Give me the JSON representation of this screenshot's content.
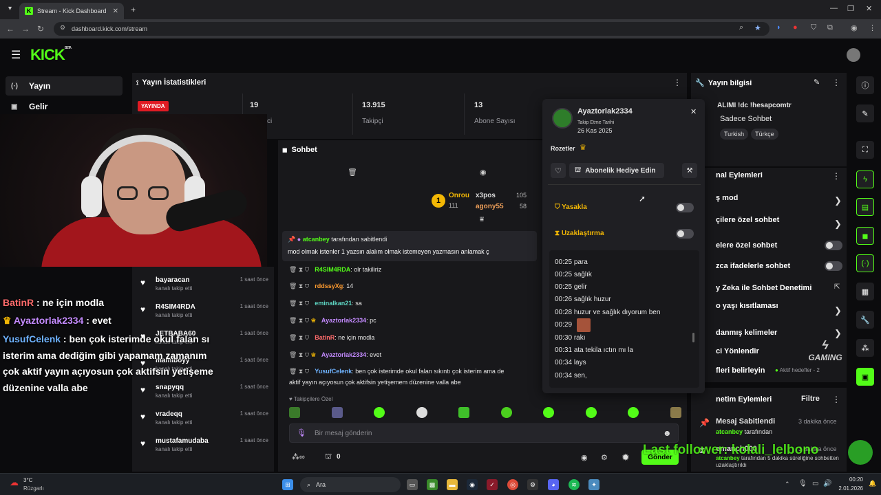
{
  "browser": {
    "tab_title": "Stream - Kick Dashboard",
    "url": "dashboard.kick.com/stream"
  },
  "header": {
    "logo": "KICK",
    "logo_sup": "BETA"
  },
  "sidebar": {
    "items": [
      {
        "label": "Yayın",
        "icon": "broadcast-icon"
      },
      {
        "label": "Gelir",
        "icon": "revenue-icon"
      }
    ]
  },
  "stats": {
    "title": "Yayın İstatistikleri",
    "live_badge": "YAYINDA",
    "viewers_value": "19",
    "viewers_label": "ci",
    "followers_value": "13.915",
    "followers_label": "Takipçi",
    "subs_value": "13",
    "subs_label": "Abone Sayısı"
  },
  "followers_list": [
    {
      "name": "bayaracan",
      "sub": "kanalı takip etti",
      "time": "1 saat önce"
    },
    {
      "name": "R4SIM4RDA",
      "sub": "kanalı takip etti",
      "time": "1 saat önce"
    },
    {
      "name": "JETBABA60",
      "sub": "kanalı takip etti",
      "time": "1 saat önce"
    },
    {
      "name": "mamiboyy",
      "sub": "kanalı takip etti",
      "time": "1 saat önce"
    },
    {
      "name": "snapyqq",
      "sub": "kanalı takip etti",
      "time": "1 saat önce"
    },
    {
      "name": "vradeqq",
      "sub": "kanalı takip etti",
      "time": "1 saat önce"
    },
    {
      "name": "mustafamudaba",
      "sub": "kanalı takip etti",
      "time": "1 saat önce"
    }
  ],
  "overlay_chat": [
    {
      "user": "BatinR",
      "text": " : ne için modla"
    },
    {
      "user": "Ayaztorlak2334",
      "text": " : evet"
    },
    {
      "user": "YusufCelenk",
      "text": " : ben çok isterimde okul falan sı"
    },
    {
      "user": "",
      "text": "isterim ama dediğim gibi yapamam zamanım"
    },
    {
      "user": "",
      "text": "çok aktif yayın açıyosun çok aktifsin yetişeme"
    },
    {
      "user": "",
      "text": "düzenine valla abe"
    }
  ],
  "chat": {
    "title": "Sohbet",
    "leaderboard": [
      {
        "name": "Onrou",
        "points": "111"
      },
      {
        "name": "x3pos",
        "points": "105"
      },
      {
        "name": "agony55",
        "points": "58"
      }
    ],
    "pinned_by": "atcanbey",
    "pinned_suffix": "tarafından sabitlendi",
    "pinned_text": "mod olmak istenler 1 yazsın alalım olmak istemeyen yazmasın anlamak ç",
    "messages": [
      {
        "user": "R4SIM4RDA",
        "text": ": olr takiliriz"
      },
      {
        "user": "rddssyXg",
        "text": ": 14"
      },
      {
        "user": "eminalkan21",
        "text": ": sa"
      },
      {
        "user": "Ayaztorlak2334",
        "text": ": pc"
      },
      {
        "user": "BatinR",
        "text": ": ne için modla"
      },
      {
        "user": "Ayaztorlak2334",
        "text": ": evet"
      },
      {
        "user": "YusufCelenk",
        "text": ": ben çok isterimde okul falan sıkıntı çok isterim ama de"
      }
    ],
    "wrap_line": "aktif yayın açıyosun çok aktifsin yetişemem düzenine valla abe",
    "followers_only": "Takipçilere Özel",
    "input_placeholder": "Bir mesaj gönderin",
    "count": "0",
    "send_label": "Gönder"
  },
  "usercard": {
    "username": "Ayaztorlak2334",
    "follow_label": "Takip Etme Tarihi",
    "follow_date": "26 Kas 2025",
    "badges_label": "Rozetler",
    "gift_label": "Abonelik Hediye Edin",
    "ban_label": "Yasakla",
    "timeout_label": "Uzaklaştırma",
    "logs": [
      {
        "time": "00:25",
        "text": "para"
      },
      {
        "time": "00:25",
        "text": "sağlık"
      },
      {
        "time": "00:25",
        "text": "gelir"
      },
      {
        "time": "00:26",
        "text": "sağlık huzur"
      },
      {
        "time": "00:28",
        "text": "huzur ve sağlık dıyorum ben"
      },
      {
        "time": "00:29",
        "text": ""
      },
      {
        "time": "00:30",
        "text": "rakı"
      },
      {
        "time": "00:31",
        "text": "ata tekila ıctın mı la"
      },
      {
        "time": "00:34",
        "text": "lays"
      },
      {
        "time": "00:34",
        "text": "sen,"
      }
    ]
  },
  "stream_info": {
    "title": "Yayın bilgisi",
    "stream_title": "ALIMI !dc !hesapcomtr",
    "category": "Sadece Sohbet",
    "tags": [
      "Turkish",
      "Türkçe"
    ]
  },
  "chat_actions": {
    "title": "nal Eylemleri",
    "rows": [
      "ş mod",
      "çilere özel sohbet",
      "elere özel sohbet",
      "zca ifadelerle sohbet",
      "y Zeka ile Sohbet Denetimi",
      "o yaşı kısıtlaması",
      "danmış kelimeler",
      "ci Yönlendir",
      "fleri belirleyin"
    ],
    "targets_label": "Aktif hedefler - 2"
  },
  "mod_actions": {
    "title": "netim Eylemleri",
    "filter": "Filtre",
    "items": [
      {
        "title": "Mesaj Sabitlendi",
        "time": "3 dakika önce",
        "user": "atcanbey",
        "suffix": "tarafından"
      },
      {
        "title": "emanch000",
        "time": "3 dakika önce",
        "user": "atcanbey",
        "suffix": "tarafından 5 dakika süreliğine sohbetten uzaklaştırıldı"
      }
    ]
  },
  "overlay_brand": "GAMING",
  "overlay_ticker": "Last follower: kolali_lelbono",
  "taskbar": {
    "weather_temp": "3°C",
    "weather_label": "Rüzgarlı",
    "search": "Ara",
    "time": "00:20",
    "date": "2.01.2026"
  },
  "colors": {
    "accent": "#53fc18",
    "live": "#e01b24",
    "panel": "#18181b"
  }
}
